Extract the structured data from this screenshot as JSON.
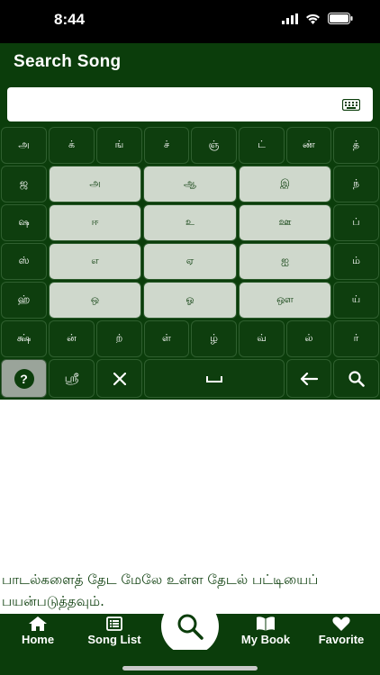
{
  "status": {
    "time": "8:44"
  },
  "header": {
    "title": "Search Song"
  },
  "search": {
    "value": "",
    "placeholder": ""
  },
  "keyboard": {
    "row1": [
      "அ",
      "க்",
      "ங்",
      "ச்",
      "ஞ்",
      "ட்",
      "ண்",
      "த்"
    ],
    "row2": {
      "left": "ஜ",
      "vowels": [
        "அ",
        "ஆ",
        "இ"
      ],
      "right": "ந்"
    },
    "row3": {
      "left": "ஷ",
      "vowels": [
        "ஈ",
        "உ",
        "ஊ"
      ],
      "right": "ப்"
    },
    "row4": {
      "left": "ஸ்",
      "vowels": [
        "எ",
        "ஏ",
        "ஐ"
      ],
      "right": "ம்"
    },
    "row5": {
      "left": "ஹ்",
      "vowels": [
        "ஒ",
        "ஓ",
        "ஔ"
      ],
      "right": "ய்"
    },
    "row6": [
      "க்ஷ்",
      "ன்",
      "ற்",
      "ள்",
      "ழ்",
      "வ்",
      "ல்",
      "ர்"
    ],
    "row7": {
      "help": "?",
      "sri": "ஶ்ரீ"
    }
  },
  "info": {
    "text": "பாடல்களைத் தேட மேலே உள்ள தேடல் பட்டியைப் பயன்படுத்தவும்."
  },
  "tabs": [
    {
      "label": "Home",
      "icon": "home-icon"
    },
    {
      "label": "Song List",
      "icon": "list-icon"
    },
    {
      "label": "My Book",
      "icon": "book-icon"
    },
    {
      "label": "Favorite",
      "icon": "heart-icon"
    }
  ]
}
